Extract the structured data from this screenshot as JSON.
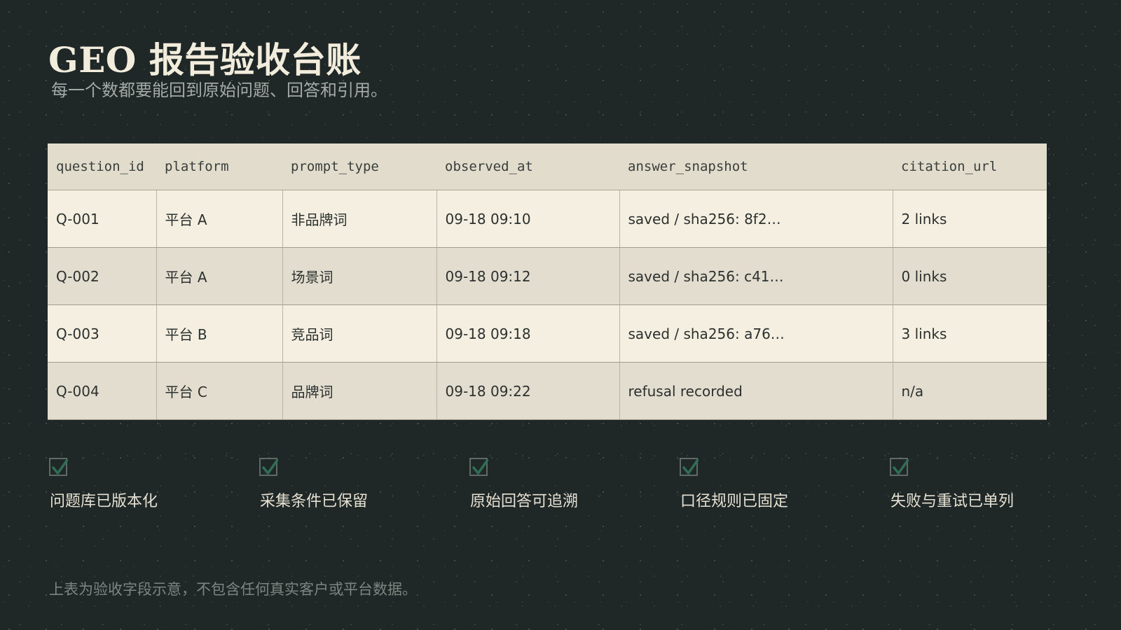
{
  "header": {
    "title": "GEO 报告验收台账",
    "subtitle": "每一个数都要能回到原始问题、回答和引用。"
  },
  "table": {
    "columns": [
      "question_id",
      "platform",
      "prompt_type",
      "observed_at",
      "answer_snapshot",
      "citation_url"
    ],
    "rows": [
      [
        "Q-001",
        "平台 A",
        "非品牌词",
        "09-18 09:10",
        "saved / sha256: 8f2…",
        "2 links"
      ],
      [
        "Q-002",
        "平台 A",
        "场景词",
        "09-18 09:12",
        "saved / sha256: c41…",
        "0 links"
      ],
      [
        "Q-003",
        "平台 B",
        "竞品词",
        "09-18 09:18",
        "saved / sha256: a76…",
        "3 links"
      ],
      [
        "Q-004",
        "平台 C",
        "品牌词",
        "09-18 09:22",
        "refusal recorded",
        "n/a"
      ]
    ]
  },
  "checklist": [
    {
      "label": "问题库已版本化",
      "checked": true,
      "icon": "checkmark-icon"
    },
    {
      "label": "采集条件已保留",
      "checked": true,
      "icon": "checkmark-icon"
    },
    {
      "label": "原始回答可追溯",
      "checked": true,
      "icon": "checkmark-icon"
    },
    {
      "label": "口径规则已固定",
      "checked": true,
      "icon": "checkmark-icon"
    },
    {
      "label": "失败与重试已单列",
      "checked": true,
      "icon": "checkmark-icon"
    }
  ],
  "footnote": "上表为验收字段示意，不包含任何真实客户或平台数据。",
  "colors": {
    "background": "#1f2727",
    "check_accent": "#2f6d55",
    "header_row": "#e1dccb",
    "row_light": "#f4efe0",
    "row_dark": "#e2ddcf"
  }
}
